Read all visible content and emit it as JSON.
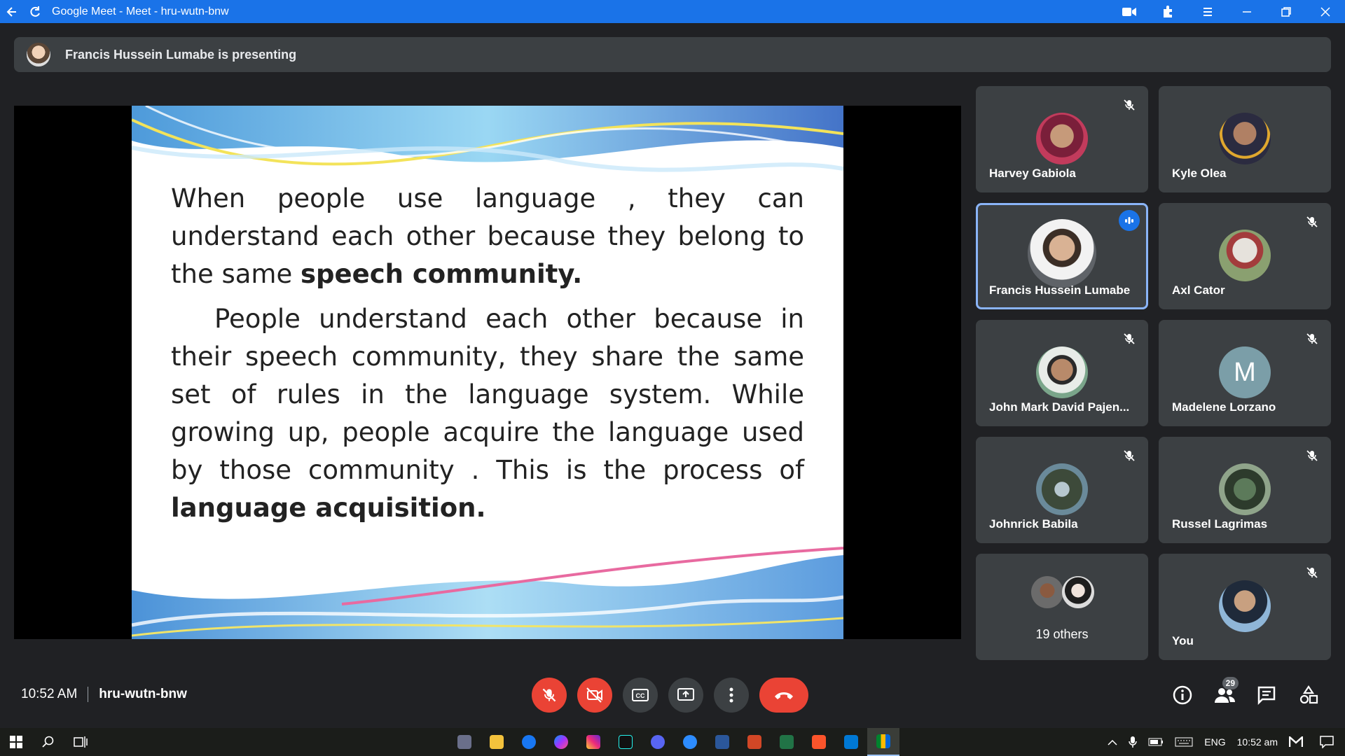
{
  "window": {
    "title": "Google Meet - Meet - hru-wutn-bnw",
    "accent": "#1a73e8"
  },
  "presenting": {
    "text": "Francis Hussein Lumabe is presenting"
  },
  "slide": {
    "paragraph1_text": "When people use language , they can understand each other because they belong to the same ",
    "paragraph1_bold": "speech community.",
    "paragraph2_text": "People understand each other because in their speech community, they share the same set of rules in the language system.  While growing up, people acquire the language used by those community . This is the process of ",
    "paragraph2_bold": "language acquisition."
  },
  "participants": [
    {
      "name": "Harvey Gabiola",
      "muted": true
    },
    {
      "name": "Kyle Olea",
      "muted": false
    },
    {
      "name": "Francis Hussein Lumabe",
      "speaking": true
    },
    {
      "name": "Axl Cator",
      "muted": true
    },
    {
      "name": "John Mark David Pajen...",
      "muted": true
    },
    {
      "name": "Madelene Lorzano",
      "muted": true,
      "initial": "M"
    },
    {
      "name": "Johnrick Babila",
      "muted": true
    },
    {
      "name": "Russel Lagrimas",
      "muted": true
    },
    {
      "others_label": "19 others"
    },
    {
      "name": "You",
      "muted": true
    }
  ],
  "controls": {
    "time": "10:52 AM",
    "meeting_code": "hru-wutn-bnw",
    "people_count": "29",
    "end_color": "#ea4335"
  },
  "taskbar": {
    "language": "ENG",
    "clock": "10:52 am"
  }
}
